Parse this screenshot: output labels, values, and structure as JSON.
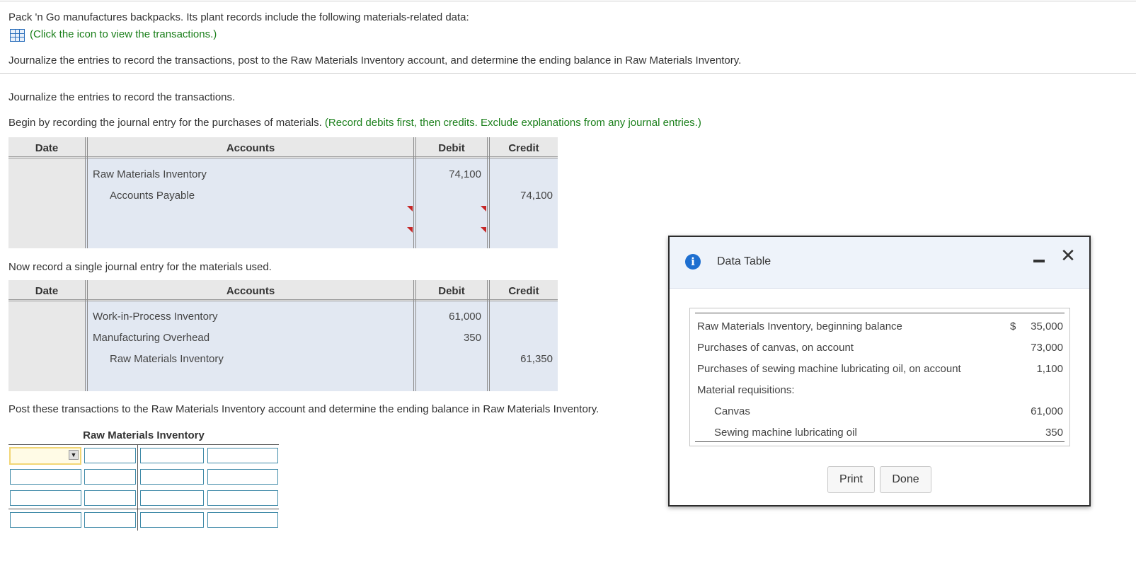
{
  "intro": {
    "line1": "Pack 'n Go manufactures backpacks. Its plant records include the following materials-related data:",
    "link": "(Click the icon to view the transactions.)",
    "task": "Journalize the entries to record the transactions, post to the Raw Materials Inventory account, and determine the ending balance in Raw Materials Inventory."
  },
  "part1": {
    "heading": "Journalize the entries to record the transactions.",
    "instruction": "Begin by recording the journal entry for the purchases of materials.",
    "note": "(Record debits first, then credits. Exclude explanations from any journal entries.)"
  },
  "columns": {
    "date": "Date",
    "accounts": "Accounts",
    "debit": "Debit",
    "credit": "Credit"
  },
  "journal1": {
    "rows": [
      {
        "account": "Raw Materials Inventory",
        "debit": "74,100",
        "credit": ""
      },
      {
        "account": "Accounts Payable",
        "debit": "",
        "credit": "74,100"
      }
    ]
  },
  "part2": {
    "instruction": "Now record a single journal entry for the materials used."
  },
  "journal2": {
    "rows": [
      {
        "account": "Work-in-Process Inventory",
        "debit": "61,000",
        "credit": ""
      },
      {
        "account": "Manufacturing Overhead",
        "debit": "350",
        "credit": ""
      },
      {
        "account": "Raw Materials Inventory",
        "debit": "",
        "credit": "61,350"
      }
    ]
  },
  "part3": {
    "instruction": "Post these transactions to the Raw Materials Inventory account and determine the ending balance in Raw Materials Inventory.",
    "t_account_title": "Raw Materials Inventory"
  },
  "dropdown_icon": "▼",
  "modal": {
    "title": "Data Table",
    "info_icon": "i",
    "close_icon": "✕",
    "rows": [
      {
        "label": "Raw Materials Inventory, beginning balance",
        "dollar": "$",
        "value": "35,000"
      },
      {
        "label": "Purchases of canvas, on account",
        "dollar": "",
        "value": "73,000"
      },
      {
        "label": "Purchases of sewing machine lubricating oil, on account",
        "dollar": "",
        "value": "1,100"
      },
      {
        "label": "Material requisitions:",
        "dollar": "",
        "value": ""
      },
      {
        "label": "Canvas",
        "dollar": "",
        "value": "61,000"
      },
      {
        "label": "Sewing machine lubricating oil",
        "dollar": "",
        "value": "350"
      }
    ],
    "print_label": "Print",
    "done_label": "Done"
  }
}
